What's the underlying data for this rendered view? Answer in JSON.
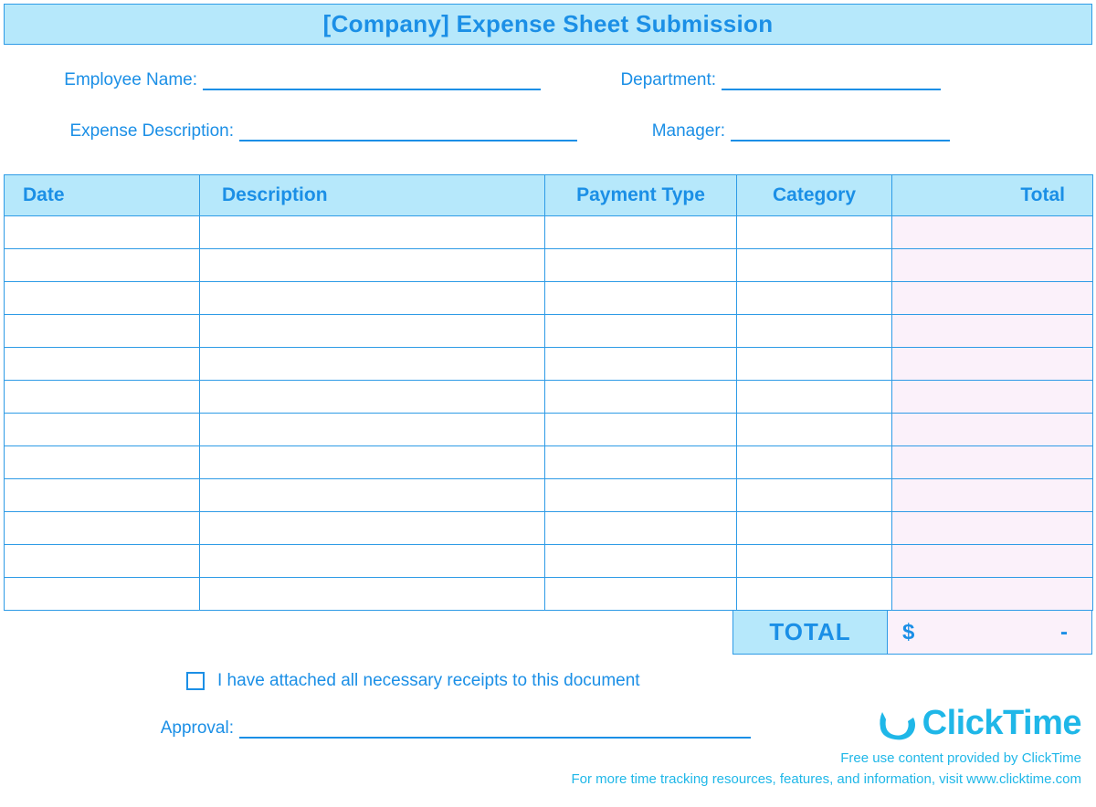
{
  "title": "[Company] Expense Sheet Submission",
  "fields": {
    "employee_name_label": "Employee Name:",
    "employee_name_value": "",
    "department_label": "Department:",
    "department_value": "",
    "expense_desc_label": "Expense Description:",
    "expense_desc_value": "",
    "manager_label": "Manager:",
    "manager_value": ""
  },
  "columns": {
    "date": "Date",
    "description": "Description",
    "payment_type": "Payment Type",
    "category": "Category",
    "total": "Total"
  },
  "rows": [
    {
      "date": "",
      "description": "",
      "payment_type": "",
      "category": "",
      "total": ""
    },
    {
      "date": "",
      "description": "",
      "payment_type": "",
      "category": "",
      "total": ""
    },
    {
      "date": "",
      "description": "",
      "payment_type": "",
      "category": "",
      "total": ""
    },
    {
      "date": "",
      "description": "",
      "payment_type": "",
      "category": "",
      "total": ""
    },
    {
      "date": "",
      "description": "",
      "payment_type": "",
      "category": "",
      "total": ""
    },
    {
      "date": "",
      "description": "",
      "payment_type": "",
      "category": "",
      "total": ""
    },
    {
      "date": "",
      "description": "",
      "payment_type": "",
      "category": "",
      "total": ""
    },
    {
      "date": "",
      "description": "",
      "payment_type": "",
      "category": "",
      "total": ""
    },
    {
      "date": "",
      "description": "",
      "payment_type": "",
      "category": "",
      "total": ""
    },
    {
      "date": "",
      "description": "",
      "payment_type": "",
      "category": "",
      "total": ""
    },
    {
      "date": "",
      "description": "",
      "payment_type": "",
      "category": "",
      "total": ""
    },
    {
      "date": "",
      "description": "",
      "payment_type": "",
      "category": "",
      "total": ""
    }
  ],
  "total": {
    "label": "TOTAL",
    "currency": "$",
    "amount": "-"
  },
  "receipts": {
    "checked": false,
    "text": "I have attached all necessary receipts to this document"
  },
  "approval": {
    "label": "Approval:",
    "value": ""
  },
  "footer": {
    "brand": "ClickTime",
    "line1": "Free use content provided by ClickTime",
    "line2": "For more time tracking resources, features, and information, visit www.clicktime.com"
  }
}
